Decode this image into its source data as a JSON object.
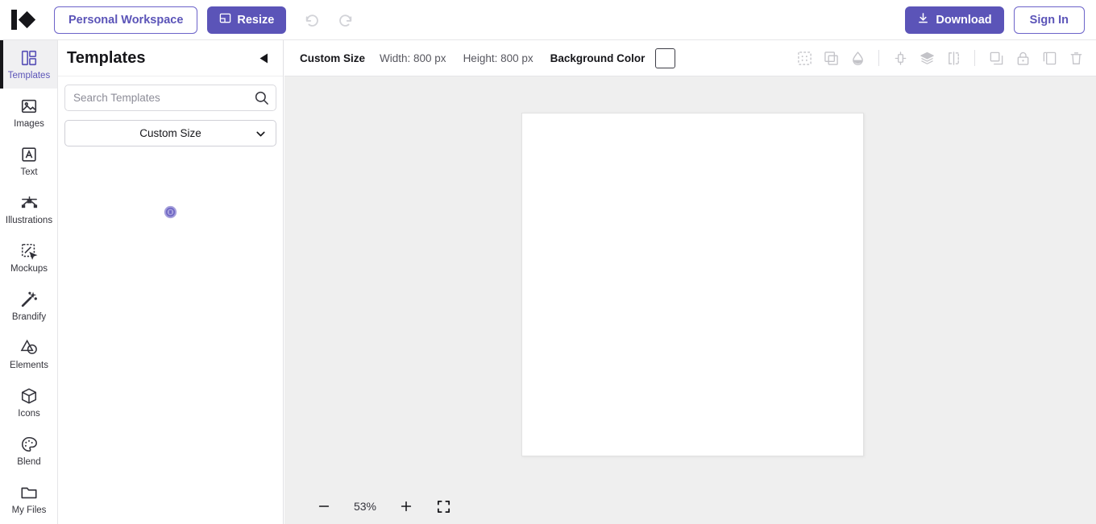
{
  "header": {
    "logo_name": "brand-logo",
    "workspace_button": "Personal Workspace",
    "resize_button": "Resize",
    "undo_icon": "undo-icon",
    "redo_icon": "redo-icon",
    "download_button": "Download",
    "signin_button": "Sign In",
    "accent_color": "#5b54b8"
  },
  "rail": {
    "items": [
      {
        "label": "Templates",
        "icon": "templates-icon",
        "active": true
      },
      {
        "label": "Images",
        "icon": "image-icon",
        "active": false
      },
      {
        "label": "Text",
        "icon": "text-icon",
        "active": false
      },
      {
        "label": "Illustrations",
        "icon": "illustrations-icon",
        "active": false
      },
      {
        "label": "Mockups",
        "icon": "mockups-icon",
        "active": false
      },
      {
        "label": "Brandify",
        "icon": "magic-wand-icon",
        "active": false
      },
      {
        "label": "Elements",
        "icon": "elements-icon",
        "active": false
      },
      {
        "label": "Icons",
        "icon": "box-icon",
        "active": false
      },
      {
        "label": "Blend",
        "icon": "palette-icon",
        "active": false
      },
      {
        "label": "My Files",
        "icon": "folder-icon",
        "active": false
      }
    ]
  },
  "panel": {
    "title": "Templates",
    "collapse_icon": "collapse-left-icon",
    "search": {
      "placeholder": "Search Templates",
      "value": "",
      "icon": "search-icon"
    },
    "size_select": {
      "selected": "Custom Size",
      "chevron_icon": "chevron-down-icon"
    },
    "loading_indicator": "loading-spinner"
  },
  "toolbar": {
    "custom_size_label": "Custom Size",
    "width_label": "Width: 800 px",
    "height_label": "Height: 800 px",
    "background_color_label": "Background Color",
    "background_color_value": "#ffffff",
    "icons": [
      "canvas-grid-icon",
      "duplicate-frame-icon",
      "fill-drop-icon",
      "align-center-icon",
      "layers-icon",
      "flip-horizontal-icon",
      "crop-icon",
      "lock-icon",
      "copy-icon",
      "delete-icon"
    ]
  },
  "canvas": {
    "artboard_background": "#ffffff",
    "workspace_background": "#efefef"
  },
  "zoombar": {
    "zoom_out_icon": "minus-icon",
    "zoom_value": "53%",
    "zoom_in_icon": "plus-icon",
    "fit_screen_icon": "fit-screen-icon"
  }
}
